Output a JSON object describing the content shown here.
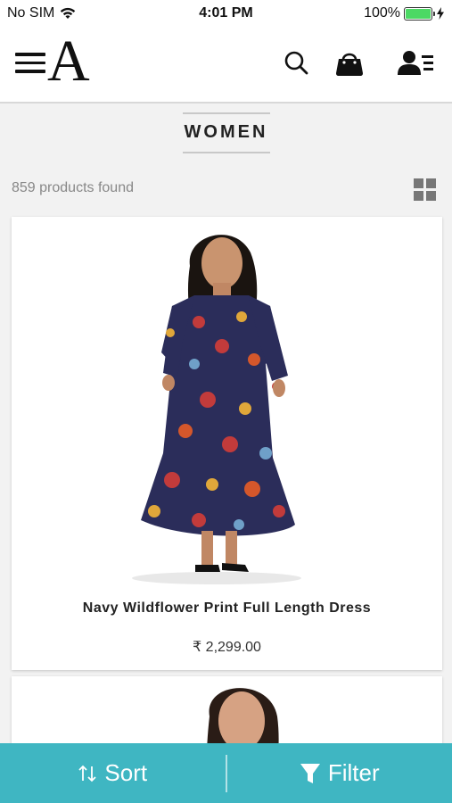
{
  "status_bar": {
    "carrier": "No SIM",
    "time": "4:01 PM",
    "battery": "100%",
    "icons": [
      "wifi-icon",
      "battery-icon",
      "charging-icon"
    ]
  },
  "header": {
    "logo": "A",
    "icons": [
      "menu-icon",
      "search-icon",
      "shopping-bag-icon",
      "account-icon"
    ]
  },
  "page": {
    "title": "WOMEN",
    "count_text": "859 products found"
  },
  "products": [
    {
      "name": "Navy Wildflower Print Full Length Dress",
      "price": "₹ 2,299.00"
    }
  ],
  "bottom_bar": {
    "sort_label": "Sort",
    "filter_label": "Filter"
  },
  "colors": {
    "accent": "#3fb6c2",
    "dress_navy": "#2b2d5a",
    "battery": "#4cd964"
  }
}
